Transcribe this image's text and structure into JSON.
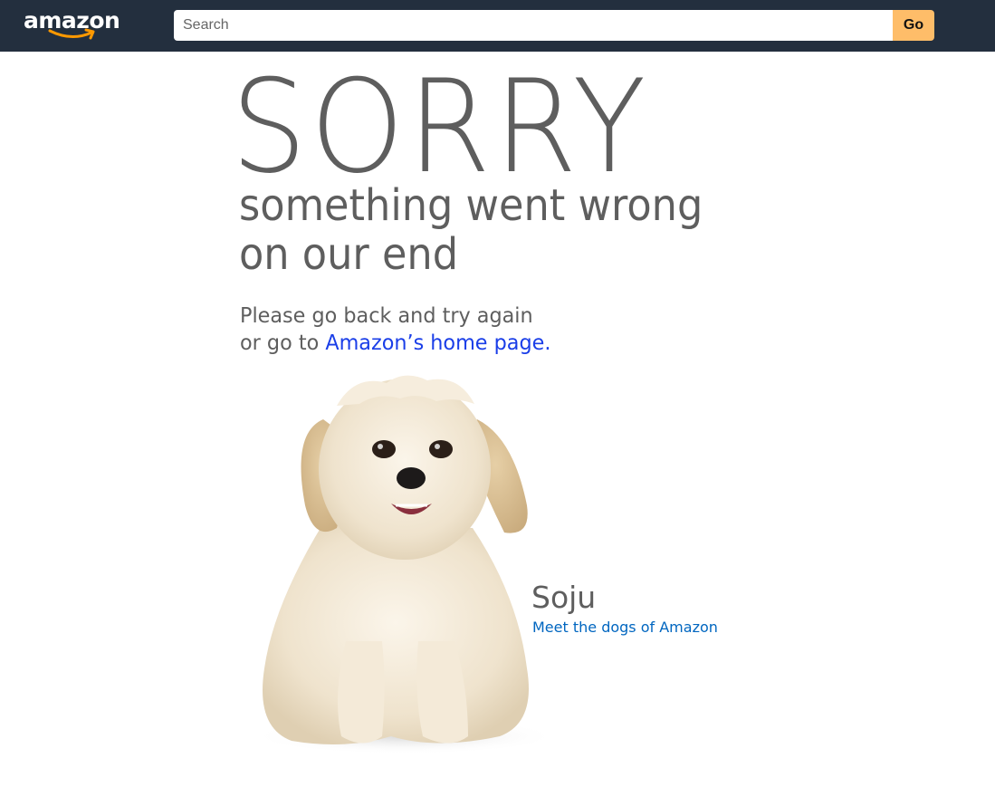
{
  "header": {
    "logo_text": "amazon",
    "search": {
      "placeholder": "Search",
      "value": ""
    },
    "go_label": "Go"
  },
  "error": {
    "headline": "SORRY",
    "subhead_line1": "something went wrong",
    "subhead_line2": "on our end",
    "message_line1": "Please go back and try again",
    "message_line2_prefix": "or go to ",
    "home_link": "Amazon’s home page."
  },
  "dog": {
    "name": "Soju",
    "link": "Meet the dogs of Amazon"
  },
  "colors": {
    "topbar": "#232f3e",
    "go_button": "#febd69",
    "smile": "#ff9900",
    "text_gray": "#5e5e5e",
    "link_blue": "#1a3ee8",
    "dogs_link_blue": "#0066c0"
  }
}
